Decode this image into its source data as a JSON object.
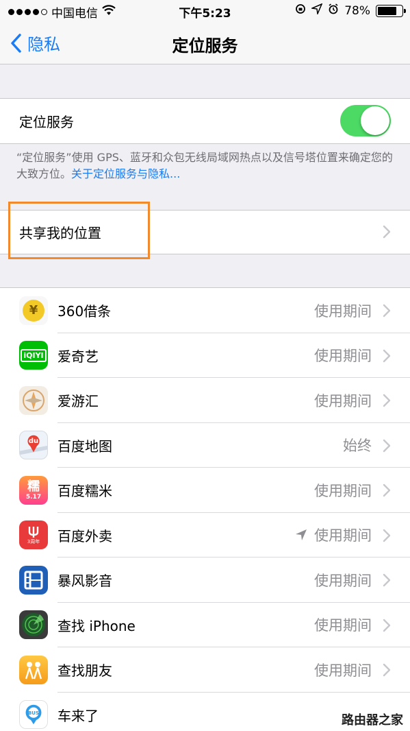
{
  "status_bar": {
    "carrier": "中国电信",
    "time": "下午5:23",
    "battery": "78%",
    "battery_level": 0.78,
    "icons": [
      "signal-dots",
      "wifi-icon",
      "orientation-lock-icon",
      "location-arrow-icon",
      "alarm-icon",
      "battery-icon"
    ]
  },
  "nav": {
    "back_label": "隐私",
    "title": "定位服务"
  },
  "location_services": {
    "label": "定位服务",
    "enabled": true
  },
  "note": {
    "text": "“定位服务”使用 GPS、蓝牙和众包无线局域网热点以及信号塔位置来确定您的大致方位。",
    "link": "关于定位服务与隐私..."
  },
  "share": {
    "label": "共享我的位置"
  },
  "apps": [
    {
      "name": "360借条",
      "status": "使用期间",
      "icon": "360-jietiao-icon",
      "color": "#f3c928"
    },
    {
      "name": "爱奇艺",
      "status": "使用期间",
      "icon": "iqiyi-icon",
      "color": "#00be06"
    },
    {
      "name": "爱游汇",
      "status": "使用期间",
      "icon": "aiyouhui-icon",
      "color": "#e9dccd"
    },
    {
      "name": "百度地图",
      "status": "始终",
      "icon": "baidu-map-icon",
      "color": "#eef3f9"
    },
    {
      "name": "百度糯米",
      "status": "使用期间",
      "icon": "baidu-nuomi-icon",
      "color": "#ff4d82"
    },
    {
      "name": "百度外卖",
      "status": "使用期间",
      "icon": "baidu-waimai-icon",
      "color": "#e83a3a",
      "recent_location": true
    },
    {
      "name": "暴风影音",
      "status": "使用期间",
      "icon": "baofeng-icon",
      "color": "#1f5fb8"
    },
    {
      "name": "查找 iPhone",
      "status": "使用期间",
      "icon": "find-iphone-icon",
      "color": "#2b2b2b"
    },
    {
      "name": "查找朋友",
      "status": "使用期间",
      "icon": "find-friends-icon",
      "color": "#f6a623"
    },
    {
      "name": "车来了",
      "status": "",
      "icon": "chelaile-icon",
      "color": "#ffffff"
    }
  ],
  "icon_text": {
    "app0": "¥",
    "app1": "iQIYI",
    "app3": "du",
    "app4_top": "糯",
    "app4_bottom": "5.17",
    "app5": "3周年",
    "app9": "BUS"
  },
  "watermark": "路由器之家"
}
